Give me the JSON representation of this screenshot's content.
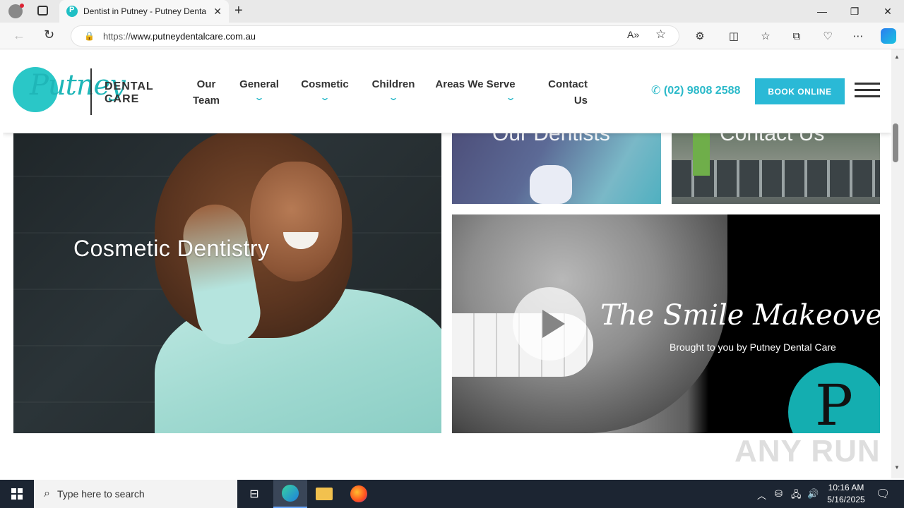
{
  "browser": {
    "tab_title": "Dentist in Putney - Putney Denta",
    "url_prefix": "https://",
    "url_host": "www.putneydentalcare.com.au",
    "window_controls": {
      "minimize": "—",
      "restore": "❐",
      "close": "✕"
    },
    "new_tab": "+"
  },
  "site": {
    "logo_script": "Putney",
    "logo_dental": "DENTAL",
    "logo_care": "CARE",
    "nav": [
      {
        "label": "Our Team",
        "line1": "Our",
        "line2": "Team"
      },
      {
        "label": "General",
        "chevron": "⌄"
      },
      {
        "label": "Cosmetic",
        "chevron": "⌄"
      },
      {
        "label": "Children",
        "chevron": "⌄"
      },
      {
        "label": "Areas We Serve",
        "chevron": "⌄"
      },
      {
        "label": "Contact Us",
        "line1": "Contact",
        "line2": "Us"
      }
    ],
    "phone": "(02) 9808 2588",
    "book_online": "BOOK ONLINE",
    "accent_color": "#2ab9c9"
  },
  "tiles": {
    "cosmetic": "Cosmetic Dentistry",
    "dentists": "Our Dentists",
    "contact": "Contact Us",
    "video_title": "The Smile Makeover",
    "video_subtitle": "Brought to you by Putney Dental Care"
  },
  "watermark": "ANY RUN",
  "taskbar": {
    "search_placeholder": "Type here to search",
    "time": "10:16 AM",
    "date": "5/16/2025"
  }
}
